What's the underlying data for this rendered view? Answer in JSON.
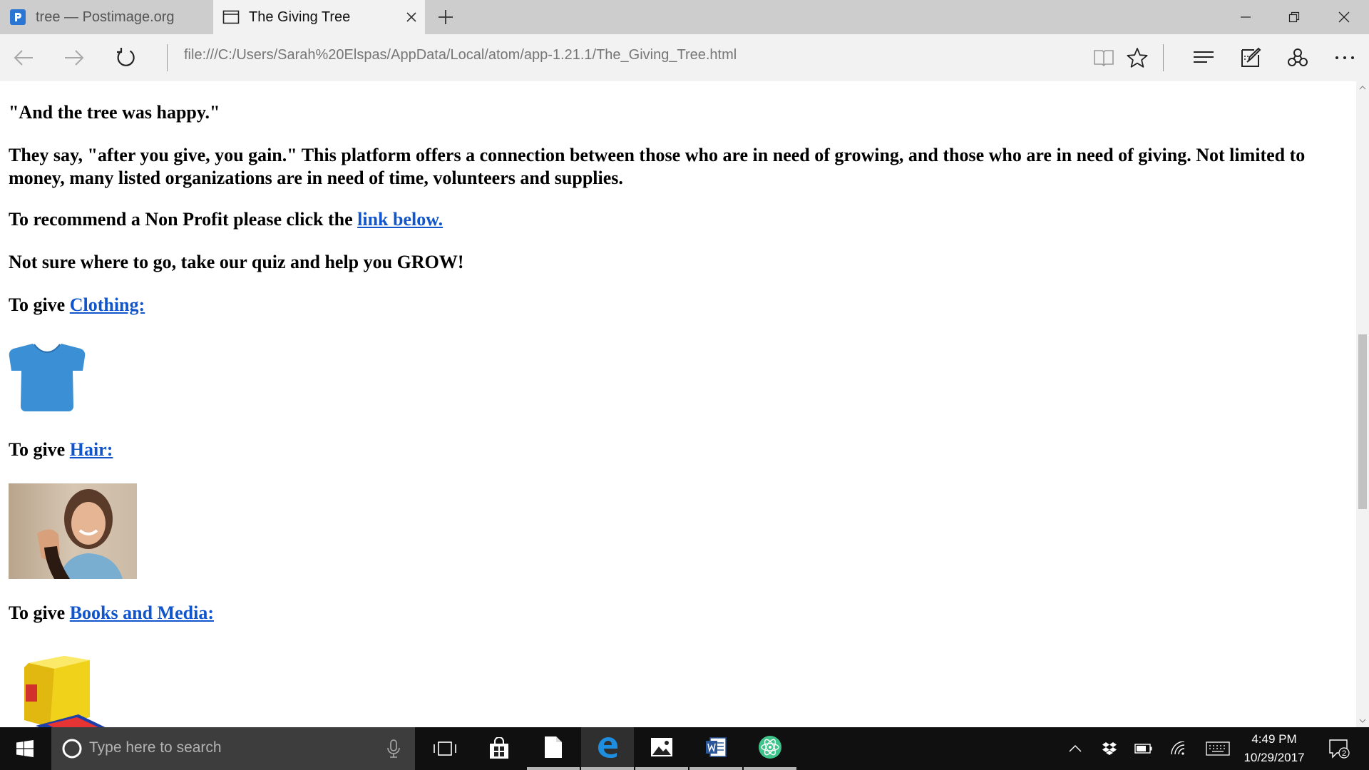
{
  "browser": {
    "tabs": [
      {
        "label": "tree — Postimage.org",
        "active": false,
        "favicon": "postimage-icon"
      },
      {
        "label": "The Giving Tree",
        "active": true,
        "favicon": "page-icon"
      }
    ],
    "address": "file:///C:/Users/Sarah%20Elspas/AppData/Local/atom/app-1.21.1/The_Giving_Tree.html"
  },
  "page": {
    "quote": "\"And the tree was happy.\"",
    "intro": "They say, \"after you give, you gain.\" This platform offers a connection between those who are in need of growing, and those who are in need of giving. Not limited to money, many listed organizations are in need of time, volunteers and supplies.",
    "recommend_text": "To recommend a Non Profit please click the ",
    "recommend_link": "link below.",
    "quiz": "Not sure where to go, take our quiz and help you GROW!",
    "to_give": "To give ",
    "clothing_link": "Clothing:",
    "hair_link": "Hair:",
    "books_link": "Books and Media:",
    "link_color": "#1155cc"
  },
  "taskbar": {
    "search_placeholder": "Type here to search",
    "time": "4:49 PM",
    "date": "10/29/2017",
    "notification_count": "2",
    "pinned_apps": [
      "task-view",
      "store",
      "file-explorer",
      "edge",
      "photos",
      "word",
      "atom"
    ]
  }
}
